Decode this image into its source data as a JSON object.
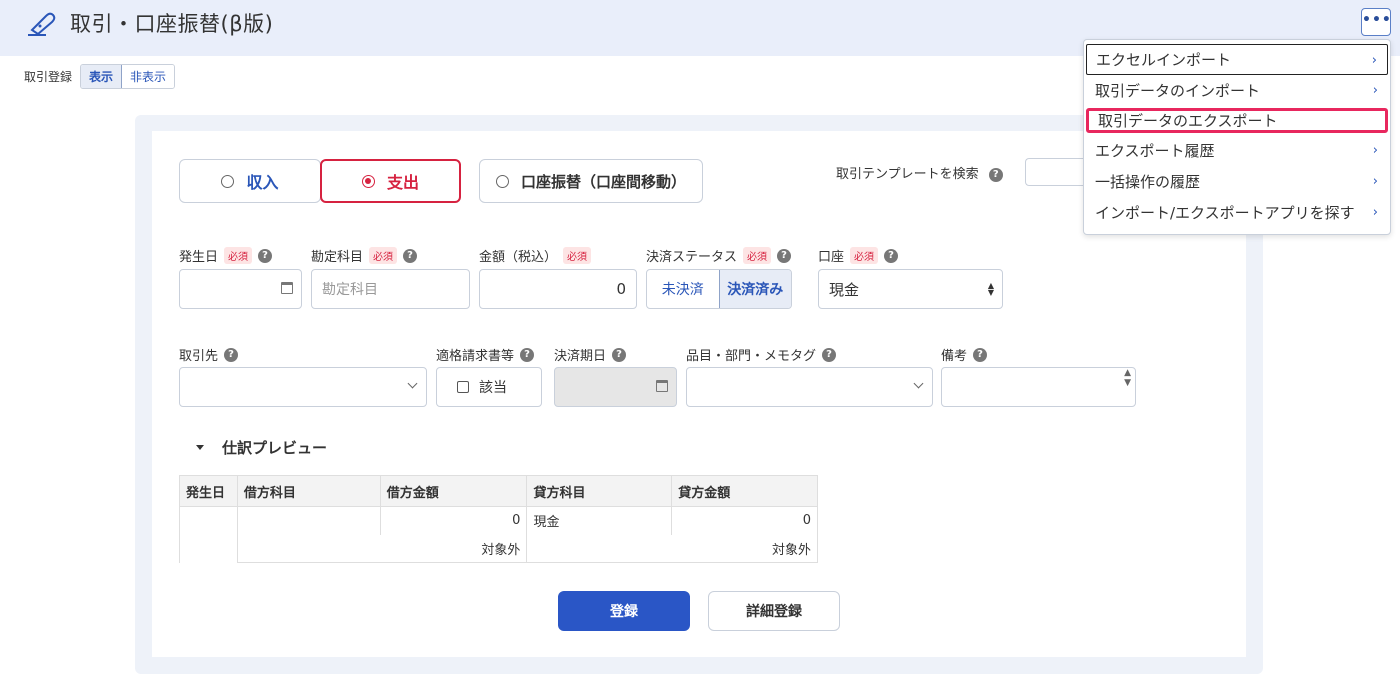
{
  "header": {
    "title": "取引・口座振替(β版)",
    "more_label": "•••"
  },
  "toggle": {
    "label": "取引登録",
    "show": "表示",
    "hide": "非表示"
  },
  "type_buttons": {
    "income": "収入",
    "expense": "支出",
    "transfer": "口座振替（口座間移動）"
  },
  "template": {
    "label": "取引テンプレートを検索"
  },
  "required_badge": "必須",
  "help_glyph": "?",
  "fields": {
    "date": {
      "label": "発生日",
      "value": ""
    },
    "account_item": {
      "label": "勘定科目",
      "placeholder": "勘定科目"
    },
    "amount": {
      "label": "金額（税込）",
      "value": "0"
    },
    "status": {
      "label": "決済ステータス",
      "unsettled": "未決済",
      "settled": "決済済み"
    },
    "wallet": {
      "label": "口座",
      "value": "現金"
    },
    "partner": {
      "label": "取引先",
      "value": ""
    },
    "invoice": {
      "label": "適格請求書等",
      "checkbox_label": "該当"
    },
    "due_date": {
      "label": "決済期日"
    },
    "tags": {
      "label": "品目・部門・メモタグ"
    },
    "memo": {
      "label": "備考"
    }
  },
  "preview": {
    "title": "仕訳プレビュー",
    "headers": [
      "発生日",
      "借方科目",
      "借方金額",
      "貸方科目",
      "貸方金額"
    ],
    "row1": {
      "date": "",
      "debit_item": "",
      "debit_amount": "0",
      "credit_item": "現金",
      "credit_amount": "0"
    },
    "row2": {
      "debit_tax": "対象外",
      "credit_tax": "対象外"
    }
  },
  "actions": {
    "register": "登録",
    "detail_register": "詳細登録"
  },
  "menu": {
    "items": [
      {
        "label": "エクセルインポート",
        "arrow": "›"
      },
      {
        "label": "取引データのインポート",
        "arrow": "›"
      },
      {
        "label": "取引データのエクスポート",
        "arrow": ""
      },
      {
        "label": "エクスポート履歴",
        "arrow": "›"
      },
      {
        "label": "一括操作の履歴",
        "arrow": "›"
      },
      {
        "label": "インポート/エクスポートアプリを探す",
        "arrow": "›"
      }
    ]
  },
  "colors": {
    "accent": "#2a56c6",
    "expense_red": "#d62240",
    "highlight": "#e8275e",
    "header_bg": "#e9eefa"
  }
}
